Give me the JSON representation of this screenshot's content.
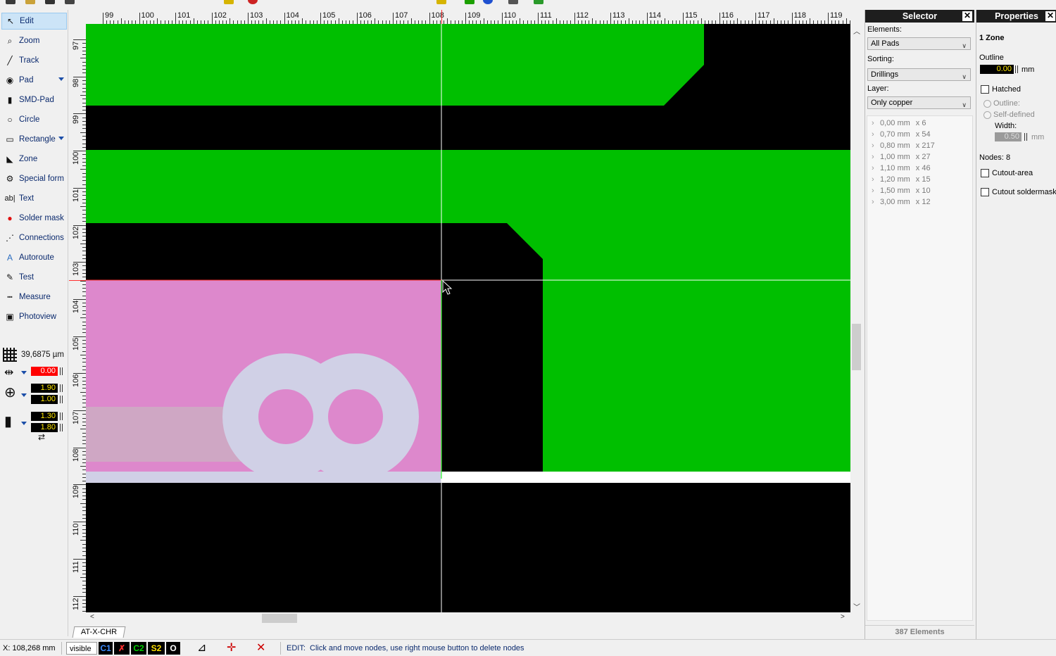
{
  "tools": [
    {
      "name": "edit",
      "label": "Edit",
      "icon": "arrow-cursor-icon",
      "active": true
    },
    {
      "name": "zoom",
      "label": "Zoom",
      "icon": "magnifier-icon"
    },
    {
      "name": "track",
      "label": "Track",
      "icon": "track-icon"
    },
    {
      "name": "pad",
      "label": "Pad",
      "icon": "pad-icon",
      "dropdown": true
    },
    {
      "name": "smd-pad",
      "label": "SMD-Pad",
      "icon": "smd-pad-icon"
    },
    {
      "name": "circle",
      "label": "Circle",
      "icon": "circle-icon"
    },
    {
      "name": "rectangle",
      "label": "Rectangle",
      "icon": "rectangle-icon",
      "dropdown": true
    },
    {
      "name": "zone",
      "label": "Zone",
      "icon": "zone-icon"
    },
    {
      "name": "special-form",
      "label": "Special form",
      "icon": "special-form-icon"
    },
    {
      "name": "text",
      "label": "Text",
      "icon": "text-icon"
    },
    {
      "name": "solder-mask",
      "label": "Solder mask",
      "icon": "solder-mask-icon"
    },
    {
      "name": "connections",
      "label": "Connections",
      "icon": "connections-icon"
    },
    {
      "name": "autoroute",
      "label": "Autoroute",
      "icon": "autoroute-icon"
    },
    {
      "name": "test",
      "label": "Test",
      "icon": "test-probe-icon"
    },
    {
      "name": "measure",
      "label": "Measure",
      "icon": "ruler-icon"
    },
    {
      "name": "photoview",
      "label": "Photoview",
      "icon": "photoview-icon"
    }
  ],
  "grid": {
    "value": "39,6875 µm"
  },
  "widths": {
    "track": "0.00",
    "pad_outer": "1.90",
    "pad_inner": "1.00",
    "smd_w": "1.30",
    "smd_h": "1.80"
  },
  "ruler": {
    "unit": "mm",
    "x_ticks": [
      "99",
      "100",
      "101",
      "102",
      "103",
      "104",
      "105",
      "106",
      "107",
      "108",
      "109",
      "110",
      "111",
      "112",
      "113",
      "114",
      "115",
      "116",
      "117",
      "118",
      "119"
    ],
    "y_ticks": [
      "97",
      "98",
      "99",
      "100",
      "101",
      "102",
      "103",
      "104",
      "105",
      "106",
      "107",
      "108",
      "109",
      "110",
      "111",
      "112"
    ]
  },
  "sheet_tab": "AT-X-CHR",
  "selector": {
    "title": "Selector",
    "elements_label": "Elements:",
    "elements_value": "All Pads",
    "sorting_label": "Sorting:",
    "sorting_value": "Drillings",
    "layer_label": "Layer:",
    "layer_value": "Only copper",
    "items": [
      {
        "size": "0,00 mm",
        "count": "x 6"
      },
      {
        "size": "0,70 mm",
        "count": "x 54"
      },
      {
        "size": "0,80 mm",
        "count": "x 217"
      },
      {
        "size": "1,00 mm",
        "count": "x 27"
      },
      {
        "size": "1,10 mm",
        "count": "x 46"
      },
      {
        "size": "1,20 mm",
        "count": "x 15"
      },
      {
        "size": "1,50 mm",
        "count": "x 10"
      },
      {
        "size": "3,00 mm",
        "count": "x 12"
      }
    ],
    "footer": "387 Elements"
  },
  "properties": {
    "title": "Properties",
    "heading": "1 Zone",
    "outline_label": "Outline",
    "outline_value": "0.00",
    "outline_unit": "mm",
    "hatched_label": "Hatched",
    "radio_outline": "Outline:",
    "radio_self": "Self-defined",
    "width_label": "Width:",
    "width_value": "0.50",
    "width_unit": "mm",
    "nodes_label": "Nodes:",
    "nodes_value": "8",
    "cutout_area": "Cutout-area",
    "cutout_soldermask": "Cutout soldermask"
  },
  "status": {
    "coord": "X:  108,268 mm",
    "visible": "visible",
    "layers": [
      {
        "label": "C1",
        "color": "#3c8cff"
      },
      {
        "label": "C2",
        "color": "#00d000"
      },
      {
        "label": "S2",
        "color": "#ffe000"
      },
      {
        "label": "O",
        "color": "#ffffff"
      }
    ],
    "hint_mode": "EDIT:",
    "hint_text": "Click and move nodes, use right mouse button to delete nodes"
  },
  "colors": {
    "copper_top": "#00bf00",
    "silk": "#d0d0e6",
    "pad_mask": "#dd88cc",
    "background": "#000000"
  }
}
